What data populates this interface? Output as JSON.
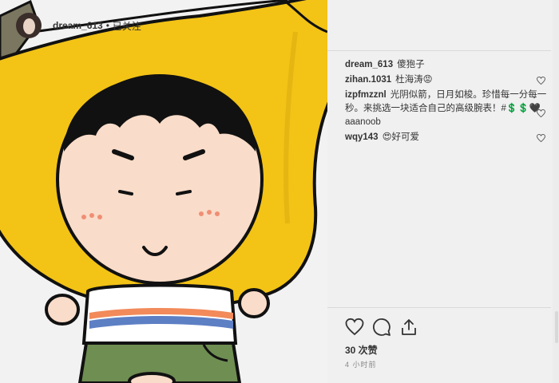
{
  "post": {
    "username": "dream_613",
    "follow_status": "已关注",
    "caption_user": "dream_613",
    "caption_text": "傻狍子",
    "comments": [
      {
        "user": "zihan.1031",
        "text": "杜海涛😡"
      },
      {
        "user": "izpfmzznl",
        "text": "光阴似箭，日月如梭。珍惜每一分每一秒。来挑选一块适合自己的高级腕表！#💲💲🖤aaanoob"
      },
      {
        "user": "wqy143",
        "text": "😍好可爱"
      }
    ],
    "likes": "30 次赞",
    "time": "4 小时前"
  },
  "icons": {
    "like": "heart-icon",
    "comment": "comment-icon",
    "share": "share-icon",
    "comment_like": "heart-icon"
  },
  "colors": {
    "banana": "#f3c316",
    "banana_dark": "#d8a90e",
    "outline": "#111111",
    "skin": "#f9dcc9",
    "blush": "#f08e74"
  }
}
